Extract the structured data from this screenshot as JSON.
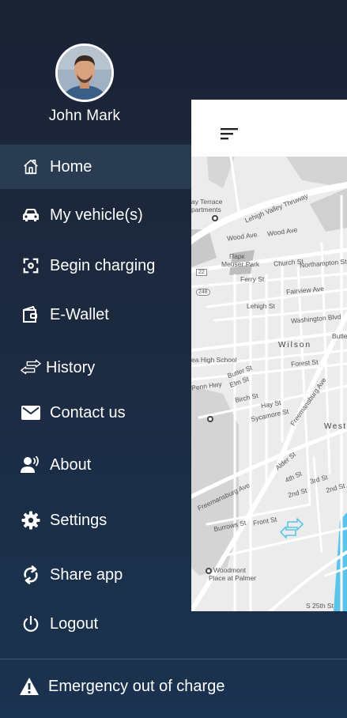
{
  "user": {
    "name": "John Mark"
  },
  "menu": [
    {
      "id": "home",
      "label": "Home",
      "icon": "home-icon",
      "active": true
    },
    {
      "id": "vehicles",
      "label": "My vehicle(s)",
      "icon": "car-icon"
    },
    {
      "id": "charging",
      "label": "Begin charging",
      "icon": "scan-icon"
    },
    {
      "id": "wallet",
      "label": "E-Wallet",
      "icon": "wallet-icon"
    },
    {
      "id": "history",
      "label": "History",
      "icon": "history-arrows-icon"
    },
    {
      "id": "contact",
      "label": "Contact us",
      "icon": "mail-icon"
    },
    {
      "id": "about",
      "label": "About",
      "icon": "about-user-icon"
    },
    {
      "id": "settings",
      "label": "Settings",
      "icon": "gear-icon"
    },
    {
      "id": "share",
      "label": "Share app",
      "icon": "refresh-icon"
    },
    {
      "id": "logout",
      "label": "Logout",
      "icon": "power-icon"
    }
  ],
  "emergency": {
    "label": "Emergency out of charge",
    "icon": "warning-icon"
  },
  "map": {
    "labels": {
      "ay_terrace": "ay Terrace",
      "apartments": "partments",
      "lehigh_thruway": "Lehigh Valley Thruway",
      "wood_ave": "Wood Ave",
      "wood_ave2": "Wood Ave",
      "park_ru": "Парк",
      "meuser_park": "Meuser Park",
      "church_st": "Church St",
      "northampton_st": "Northampton St",
      "ferry_st": "Ferry St",
      "fairview_ave": "Fairview Ave",
      "lehigh_st": "Lehigh St",
      "washington_blvd": "Washington Blvd",
      "butler_st": "Butler S",
      "wilson": "Wilson",
      "high_school": "ea High School",
      "forest_st": "Forest St",
      "penn_hwy": "Penn Hwy",
      "butler_st2": "Butler St",
      "elm_st": "Elm St",
      "birch_st": "Birch St",
      "hay_st": "Hay St",
      "sycamore_st": "Sycamore St",
      "freemansburg_ave": "Freemansburg Ave",
      "west": "West",
      "alder_st": "Alder St",
      "4th_st": "4th St",
      "3rd_st": "3rd St",
      "2nd_st": "2nd St",
      "2nd_st2": "2nd St",
      "freemansburg_ave2": "Freemansburg Ave",
      "front_st": "Front St",
      "burrows_st": "Burrows St",
      "woodmont": "Woodmont",
      "place_at_palmer": "Place at Palmer",
      "s_25th": "S 25th St",
      "22": "22",
      "248": "248"
    }
  },
  "colors": {
    "drawer_top": "#1b2234",
    "drawer_bottom": "#1a3350",
    "active_item": "#2a3c52",
    "map_bg": "#ececec",
    "swap_arrows": "#5bc4ea"
  }
}
